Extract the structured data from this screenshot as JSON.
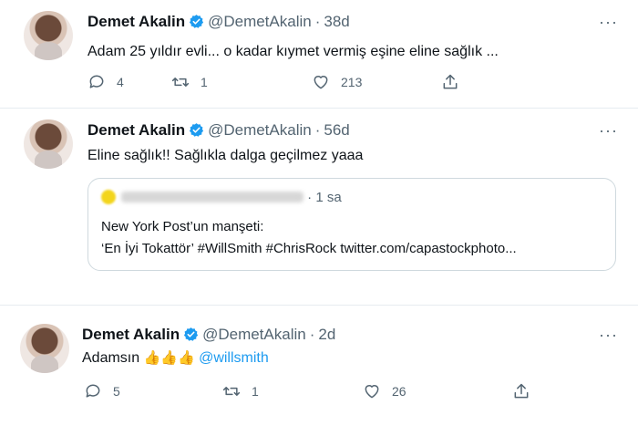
{
  "tweets": [
    {
      "name": "Demet Akalin",
      "handle": "@DemetAkalin",
      "dot": "·",
      "time": "38d",
      "text": "Adam 25 yıldır evli... o kadar kıymet vermiş eşine eline sağlık ...",
      "replies": "4",
      "retweets": "1",
      "likes": "213"
    },
    {
      "name": "Demet Akalin",
      "handle": "@DemetAkalin",
      "dot": "·",
      "time": "56d",
      "text": "Eline sağlık!! Sağlıkla dalga geçilmez yaaa",
      "quote": {
        "time": "· 1 sa",
        "line1": "New York Post’un manşeti:",
        "line2": "‘En İyi Tokattör’ #WillSmith #ChrisRock twitter.com/capastockphoto..."
      }
    },
    {
      "name": "Demet Akalin",
      "handle": "@DemetAkalin",
      "dot": "·",
      "time": "2d",
      "text_prefix": "Adamsın",
      "emojis": "👍👍👍",
      "mention": "@willsmith",
      "replies": "5",
      "retweets": "1",
      "likes": "26"
    }
  ],
  "more_label": "···",
  "colors": {
    "accent": "#1d9bf0",
    "secondary": "#536471",
    "text": "#0f1419",
    "border": "#cfd9de"
  },
  "icons": [
    "reply-icon",
    "retweet-icon",
    "like-icon",
    "share-icon",
    "verified-badge-icon",
    "more-icon"
  ]
}
